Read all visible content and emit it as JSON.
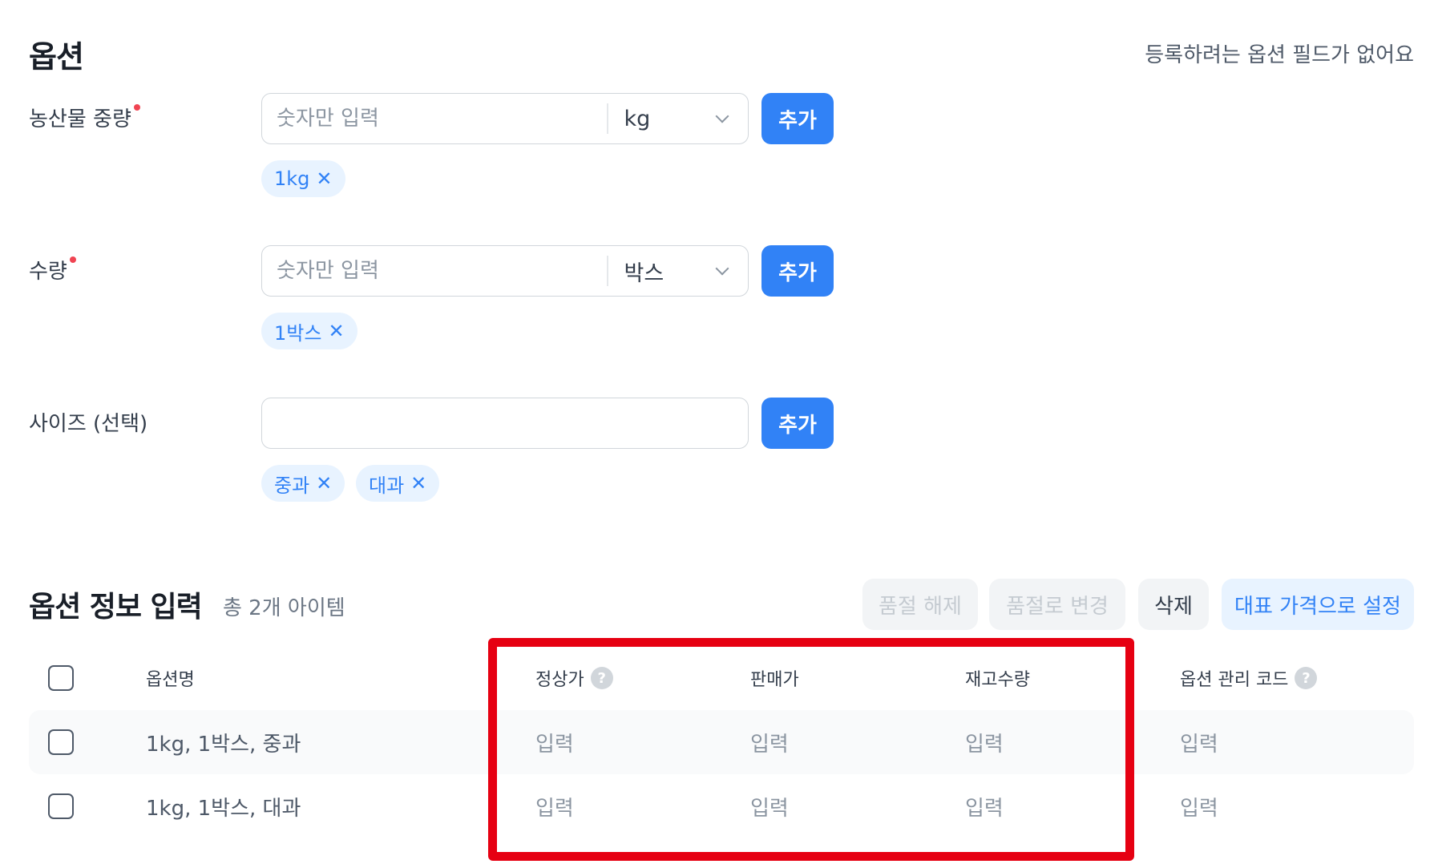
{
  "section": {
    "title": "옵션",
    "note": "등록하려는 옵션 필드가 없어요"
  },
  "fields": [
    {
      "label": "농산물 중량",
      "placeholder": "숫자만 입력",
      "unit": "kg",
      "add_label": "추가",
      "chips": [
        "1kg"
      ]
    },
    {
      "label": "수량",
      "placeholder": "숫자만 입력",
      "unit": "박스",
      "add_label": "추가",
      "chips": [
        "1박스"
      ]
    },
    {
      "label": "사이즈 (선택)",
      "placeholder": "",
      "add_label": "추가",
      "chips": [
        "중과",
        "대과"
      ]
    }
  ],
  "chip_remove_glyph": "✕",
  "info": {
    "title": "옵션 정보 입력",
    "count": "총 2개 아이템",
    "actions": [
      "품절 해제",
      "품절로 변경",
      "삭제",
      "대표 가격으로 설정"
    ]
  },
  "table": {
    "columns": [
      "옵션명",
      "정상가",
      "판매가",
      "재고수량",
      "옵션 관리 코드"
    ],
    "help_glyph": "?",
    "rows": [
      {
        "name": "1kg, 1박스, 중과",
        "cells": [
          "입력",
          "입력",
          "입력",
          "입력"
        ]
      },
      {
        "name": "1kg, 1박스, 대과",
        "cells": [
          "입력",
          "입력",
          "입력",
          "입력"
        ]
      }
    ]
  },
  "colors": {
    "primary": "#3182f6",
    "chip_bg": "#e8f3ff",
    "required_dot": "#f04452",
    "highlight_border": "#e60012"
  }
}
